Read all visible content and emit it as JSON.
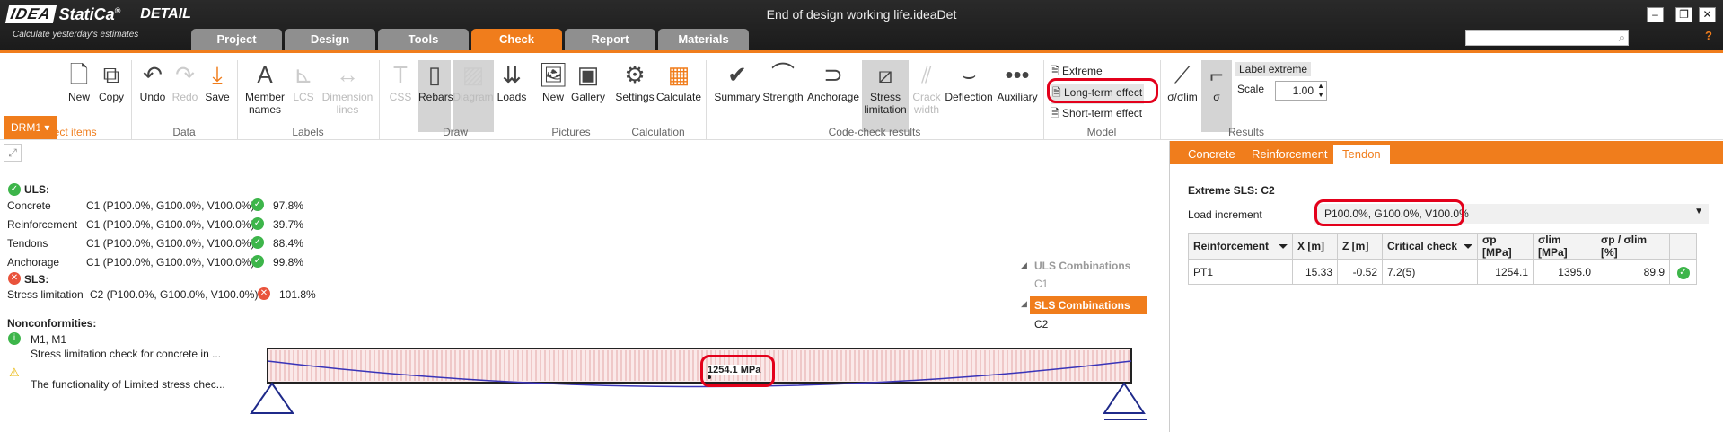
{
  "app": {
    "brand": "IDEA",
    "brand2": "StatiCa",
    "registered": "®",
    "product": "DETAIL",
    "tagline": "Calculate yesterday's estimates",
    "document_title": "End of design working life.ideaDet",
    "help": "?"
  },
  "window_controls": {
    "minimize": "–",
    "maximize": "❐",
    "close": "✕"
  },
  "tabs": [
    {
      "label": "Project"
    },
    {
      "label": "Design"
    },
    {
      "label": "Tools"
    },
    {
      "label": "Check"
    },
    {
      "label": "Report"
    },
    {
      "label": "Materials"
    }
  ],
  "ribbon": {
    "project_selector": "DRM1",
    "groups": {
      "project_items": "Project items",
      "data": "Data",
      "labels": "Labels",
      "draw": "Draw",
      "pictures": "Pictures",
      "calculation": "Calculation",
      "code_check_results": "Code-check results",
      "model": "Model",
      "results": "Results"
    },
    "buttons": {
      "new": "New",
      "copy": "Copy",
      "undo": "Undo",
      "redo": "Redo",
      "save": "Save",
      "member": "Member",
      "member2": "names",
      "lcs": "LCS",
      "dim": "Dimension",
      "dim2": "lines",
      "css": "CSS",
      "rebars": "Rebars",
      "diagram": "Diagram",
      "loads": "Loads",
      "pic_new": "New",
      "gallery": "Gallery",
      "settings": "Settings",
      "calculate": "Calculate",
      "summary": "Summary",
      "strength": "Strength",
      "anchorage": "Anchorage",
      "stress": "Stress",
      "stress2": "limitation",
      "crack": "Crack",
      "crack2": "width",
      "deflection": "Deflection",
      "auxiliary": "Auxiliary",
      "extreme": "Extreme",
      "long_term": "Long-term effect",
      "short_term": "Short-term effect",
      "sigma_lim": "σ/σlim",
      "sigma": "σ",
      "label_extreme": "Label extreme",
      "scale": "Scale",
      "scale_value": "1.00"
    }
  },
  "summary": {
    "uls_title": "ULS:",
    "uls": [
      {
        "name": "Concrete",
        "combo": "C1 (P100.0%, G100.0%, V100.0%)",
        "value": "97.8%"
      },
      {
        "name": "Reinforcement",
        "combo": "C1 (P100.0%, G100.0%, V100.0%)",
        "value": "39.7%"
      },
      {
        "name": "Tendons",
        "combo": "C1 (P100.0%, G100.0%, V100.0%)",
        "value": "88.4%"
      },
      {
        "name": "Anchorage",
        "combo": "C1 (P100.0%, G100.0%, V100.0%)",
        "value": "99.8%"
      }
    ],
    "sls_title": "SLS:",
    "sls": {
      "name": "Stress limitation",
      "combo": "C2 (P100.0%, G100.0%, V100.0%)",
      "value": "101.8%"
    },
    "nonconf_title": "Nonconformities:",
    "nonconf_member": "M1, M1",
    "nonconf_1": "Stress limitation check for concrete in ...",
    "nonconf_2": "The functionality of Limited stress chec..."
  },
  "combinations": {
    "uls_header": "ULS Combinations",
    "uls_item": "C1",
    "sls_header": "SLS Combinations",
    "sls_item": "C2"
  },
  "beam": {
    "label": "1254.1 MPa"
  },
  "right_panel": {
    "tabs": [
      "Concrete",
      "Reinforcement",
      "Tendon"
    ],
    "heading": "Extreme SLS: C2",
    "load_increment_label": "Load increment",
    "load_increment_value": "P100.0%, G100.0%, V100.0%",
    "table": {
      "headers": [
        "Reinforcement",
        "X [m]",
        "Z [m]",
        "Critical check",
        "σp [MPa]",
        "σlim [MPa]",
        "σp / σlim [%]"
      ],
      "rows": [
        [
          "PT1",
          "15.33",
          "-0.52",
          "7.2(5)",
          "1254.1",
          "1395.0",
          "89.9"
        ]
      ]
    }
  },
  "colors": {
    "accent": "#f07d1c",
    "ok": "#3db54a",
    "fail": "#e9533b",
    "highlight": "#e3001b",
    "tendon": "#3a34b8"
  }
}
